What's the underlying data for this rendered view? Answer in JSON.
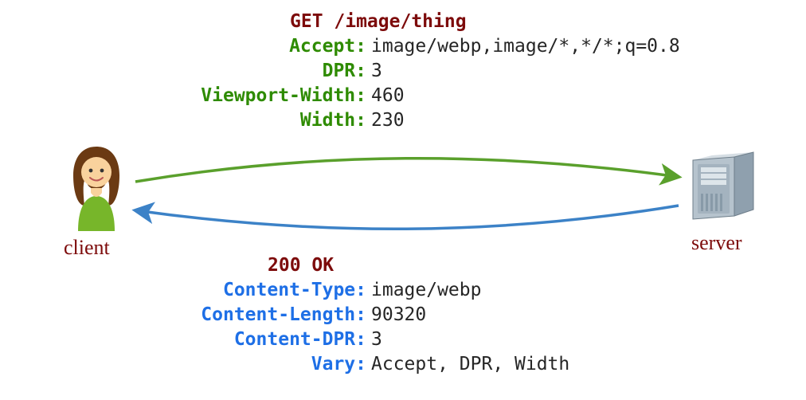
{
  "request": {
    "status_line": "GET /image/thing",
    "headers": [
      {
        "k": "Accept:",
        "v": "image/webp,image/*,*/*;q=0.8"
      },
      {
        "k": "DPR:",
        "v": "3"
      },
      {
        "k": "Viewport-Width:",
        "v": "460"
      },
      {
        "k": "Width:",
        "v": "230"
      }
    ]
  },
  "response": {
    "status_line": "200 OK",
    "headers": [
      {
        "k": "Content-Type:",
        "v": "image/webp"
      },
      {
        "k": "Content-Length:",
        "v": "90320"
      },
      {
        "k": "Content-DPR:",
        "v": "3"
      },
      {
        "k": "Vary:",
        "v": "Accept, DPR, Width"
      }
    ]
  },
  "labels": {
    "client": "client",
    "server": "server"
  },
  "colors": {
    "request_arrow": "#5AA02C",
    "response_arrow": "#3C82C7",
    "header_key_req": "#2E8B00",
    "header_key_res": "#1E6FE6",
    "status": "#7D0B0B",
    "label": "#7D0B0B"
  }
}
